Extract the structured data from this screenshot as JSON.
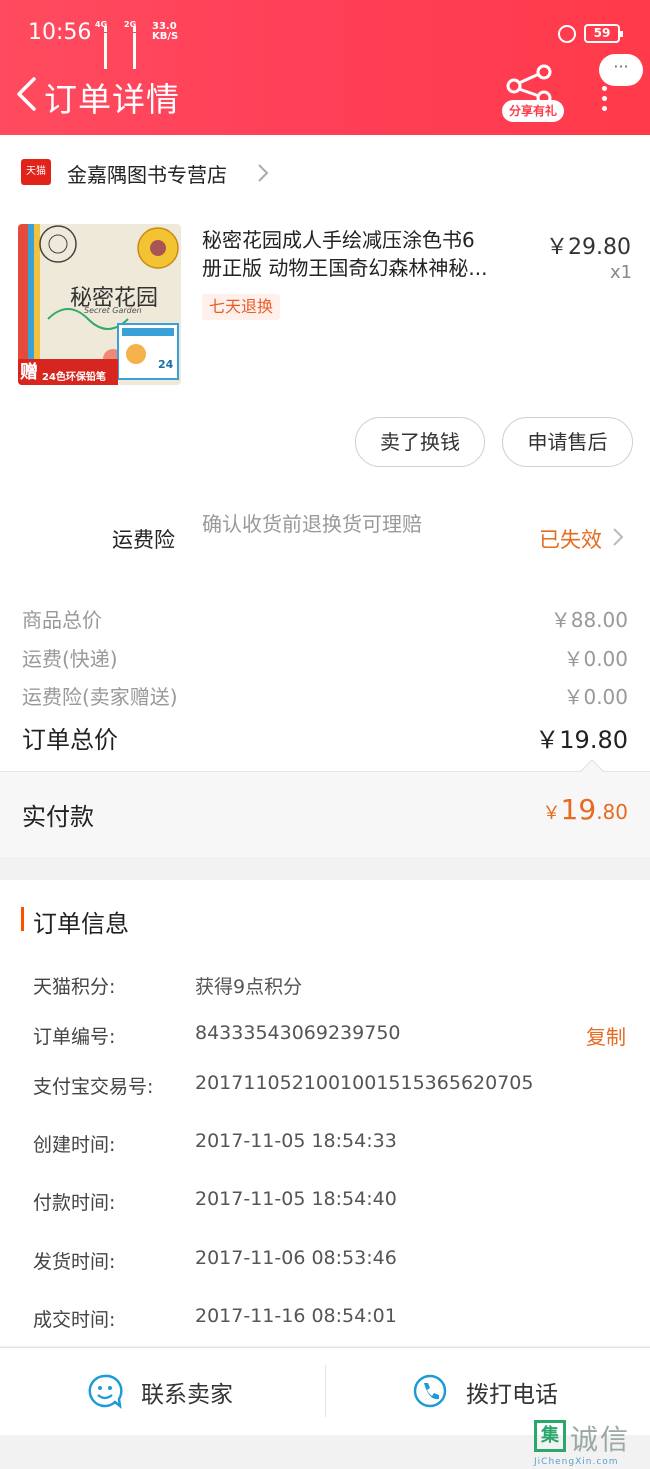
{
  "status_bar": {
    "time": "10:56",
    "net1": "4G",
    "net2": "2G",
    "speed_value": "33.0",
    "speed_unit": "KB/S",
    "battery": "59"
  },
  "header": {
    "title": "订单详情",
    "share_label": "分享有礼",
    "bubble_label": "···"
  },
  "store": {
    "badge": "天猫",
    "name": "金嘉隅图书专营店"
  },
  "product": {
    "title_line1": "秘密花园成人手绘减压涂色书6",
    "title_line2": "册正版 动物王国奇幻森林神秘...",
    "price": "￥29.80",
    "qty": "x1",
    "badge": "七天退换",
    "img_title": "秘密花园",
    "img_subtitle": "Secret Garden",
    "img_gift_big": "赠",
    "img_gift": "24色环保铅笔",
    "img_gift_count": "24"
  },
  "actions": {
    "sell": "卖了换钱",
    "after_sale": "申请售后"
  },
  "insurance": {
    "label": "运费险",
    "desc": "确认收货前退换货可理赔",
    "status": "已失效"
  },
  "fees": [
    {
      "label": "商品总价",
      "value": "￥88.00"
    },
    {
      "label": "运费(快递)",
      "value": "￥0.00"
    },
    {
      "label": "运费险(卖家赠送)",
      "value": "￥0.00"
    }
  ],
  "total": {
    "label": "订单总价",
    "value": "￥19.80"
  },
  "paid": {
    "label": "实付款",
    "symbol": "￥",
    "integer": "19",
    "decimal": ".80"
  },
  "order_info": {
    "title": "订单信息",
    "copy_label": "复制",
    "rows": [
      {
        "key": "天猫积分:",
        "value": "获得9点积分"
      },
      {
        "key": "订单编号:",
        "value": "84333543069239750"
      },
      {
        "key": "支付宝交易号:",
        "value": "2017110521001001515365620705"
      },
      {
        "key": "创建时间:",
        "value": "2017-11-05 18:54:33"
      },
      {
        "key": "付款时间:",
        "value": "2017-11-05 18:54:40"
      },
      {
        "key": "发货时间:",
        "value": "2017-11-06 08:53:46"
      },
      {
        "key": "成交时间:",
        "value": "2017-11-16 08:54:01"
      }
    ]
  },
  "bottom": {
    "contact_seller": "联系卖家",
    "call_phone": "拨打电话"
  },
  "watermark": {
    "mark": "集",
    "text": "诚信",
    "url": "JiChengXin.com"
  },
  "colors": {
    "header_red": "#ff4158",
    "accent_orange": "#e86a1f",
    "icon_blue": "#1e9bd7"
  }
}
